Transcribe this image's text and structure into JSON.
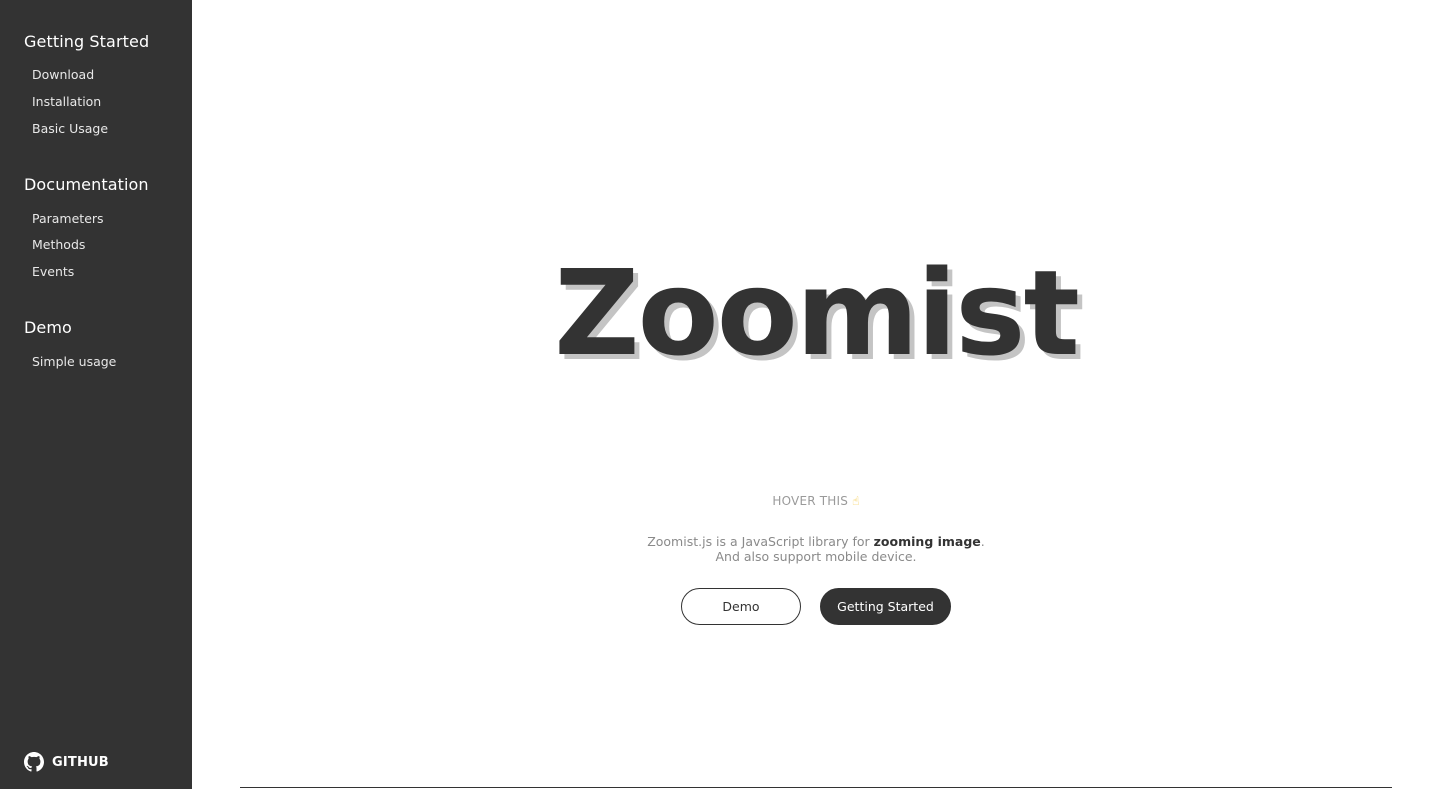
{
  "sidebar": {
    "groups": [
      {
        "heading": "Getting Started",
        "items": [
          {
            "label": "Download"
          },
          {
            "label": "Installation"
          },
          {
            "label": "Basic Usage"
          }
        ]
      },
      {
        "heading": "Documentation",
        "items": [
          {
            "label": "Parameters"
          },
          {
            "label": "Methods"
          },
          {
            "label": "Events"
          }
        ]
      },
      {
        "heading": "Demo",
        "items": [
          {
            "label": "Simple usage"
          }
        ]
      }
    ],
    "github": {
      "label": "GITHUB",
      "icon": "github-icon"
    }
  },
  "hero": {
    "title": "Zoomist",
    "hint": "HOVER THIS",
    "hint_icon": "pointing-hand-icon",
    "description_prefix": "Zoomist.js is a JavaScript library for",
    "description_bold": "zooming image",
    "description_suffix": ".",
    "description_line2": "And also support mobile device."
  },
  "buttons": {
    "demo_label": "Demo",
    "start_label": "Getting Started"
  },
  "colors": {
    "sidebar_bg": "#333333",
    "text_dark": "#333333",
    "title_shadow": "#c4c4c4"
  }
}
